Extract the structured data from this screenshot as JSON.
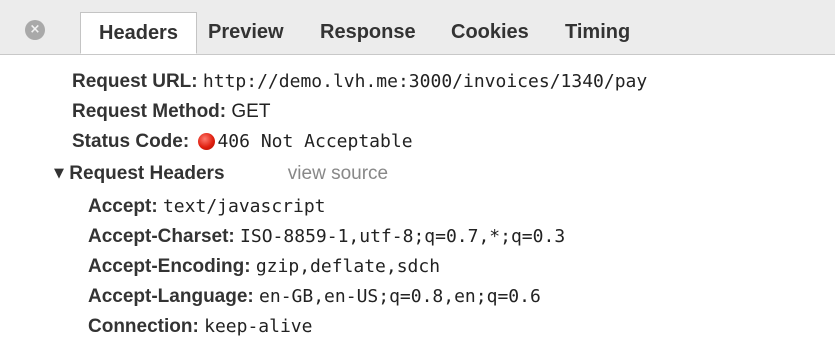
{
  "tabs": {
    "close_icon": "×",
    "items": [
      "Headers",
      "Preview",
      "Response",
      "Cookies",
      "Timing"
    ],
    "active": "Headers"
  },
  "general": {
    "request_url_key": "Request URL:",
    "request_url_value": "http://demo.lvh.me:3000/invoices/1340/pay",
    "request_method_key": "Request Method:",
    "request_method_value": "GET",
    "status_code_key": "Status Code:",
    "status_code_value": "406 Not Acceptable",
    "status_color": "#e02010"
  },
  "request_headers": {
    "toggle_icon": "▼",
    "title": "Request Headers",
    "view_source_label": "view source",
    "items": [
      {
        "key": "Accept:",
        "value": "text/javascript"
      },
      {
        "key": "Accept-Charset:",
        "value": "ISO-8859-1,utf-8;q=0.7,*;q=0.3"
      },
      {
        "key": "Accept-Encoding:",
        "value": "gzip,deflate,sdch"
      },
      {
        "key": "Accept-Language:",
        "value": "en-GB,en-US;q=0.8,en;q=0.6"
      },
      {
        "key": "Connection:",
        "value": "keep-alive"
      }
    ]
  }
}
